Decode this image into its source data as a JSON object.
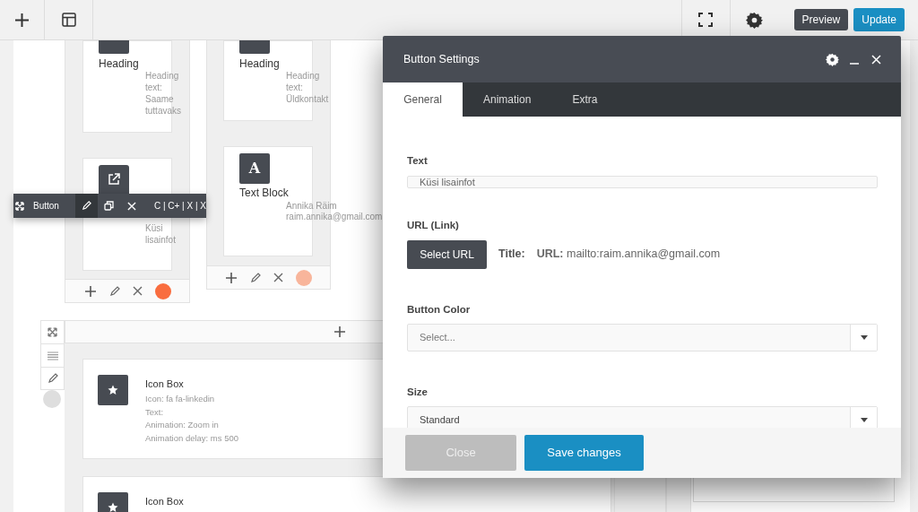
{
  "topbar": {
    "preview": "Preview",
    "update": "Update"
  },
  "columns": [
    {
      "elements": [
        {
          "kind": "heading",
          "title": "Heading",
          "details": "Heading text: Saame tuttavaks"
        },
        {
          "kind": "button",
          "details": "Küsi lisainfot"
        }
      ],
      "color": "#f96d3f"
    },
    {
      "elements": [
        {
          "kind": "heading",
          "title": "Heading",
          "details": "Heading text: Üldkontakt"
        },
        {
          "kind": "text",
          "glyph": "A",
          "title": "Text Block",
          "details": "Annika Räim raim.annika@gmail.com"
        }
      ],
      "color": "#f8b59b"
    }
  ],
  "element_toolbar": {
    "label": "Button",
    "shortcuts": "C | C+ | X | X"
  },
  "row": {
    "elements": [
      {
        "title": "Icon Box",
        "lines": [
          "Icon: fa fa-linkedin",
          "Text:",
          "Animation: Zoom in",
          "Animation delay: ms 500"
        ]
      },
      {
        "title": "Icon Box"
      }
    ]
  },
  "modal": {
    "title": "Button Settings",
    "tabs": [
      {
        "label": "General",
        "selected": true
      },
      {
        "label": "Animation",
        "selected": false
      },
      {
        "label": "Extra",
        "selected": false
      }
    ],
    "text_label": "Text",
    "text_value": "Küsi lisainfot",
    "url_label": "URL (Link)",
    "select_url": "Select URL",
    "title_label": "Title:",
    "url_line": "**URL:** mailto:raim.annika@gmail.com",
    "color_label": "Button Color",
    "color_placeholder": "Select...",
    "size_label": "Size",
    "size_value": "Standard",
    "close": "Close",
    "save": "Save changes"
  }
}
